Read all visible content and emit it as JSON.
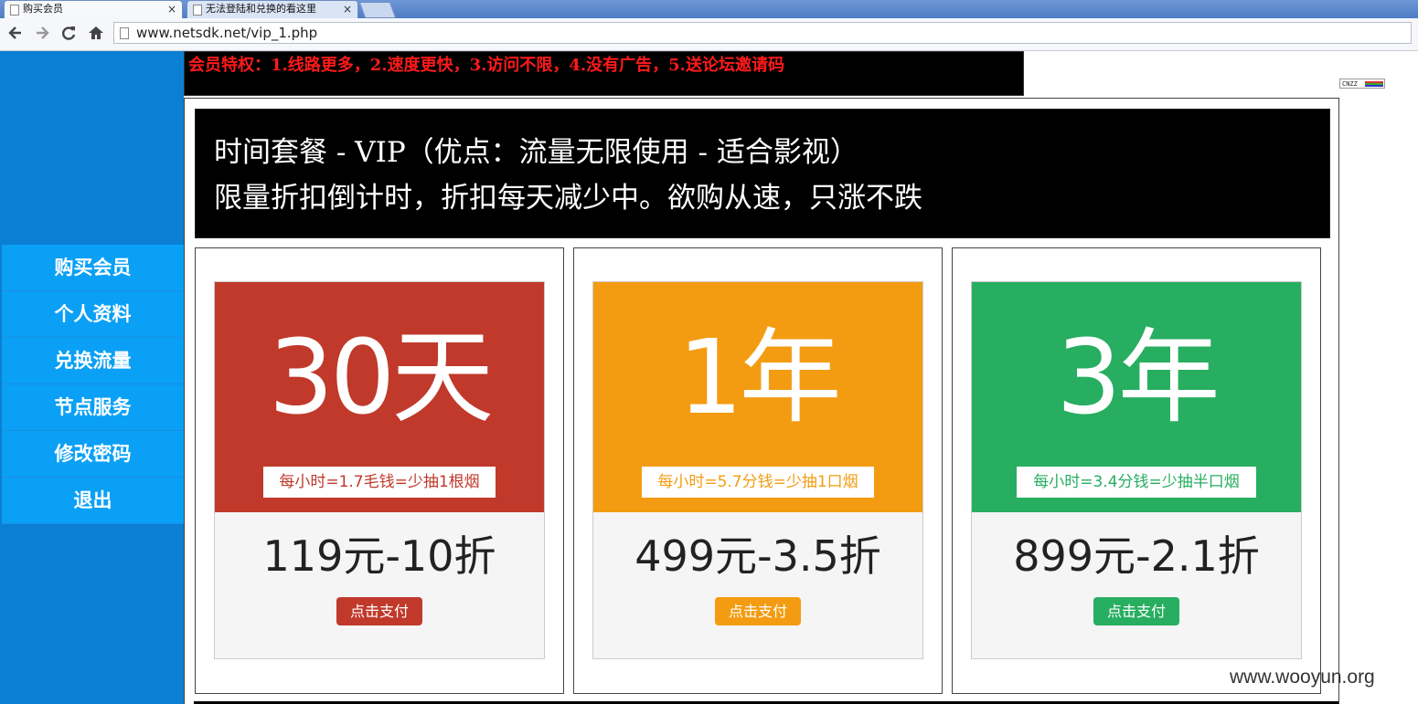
{
  "browser": {
    "tabs": [
      {
        "title": "购买会员",
        "close": "×"
      },
      {
        "title": "无法登陆和兑换的看这里",
        "close": "×"
      }
    ],
    "url": "www.netsdk.net/vip_1.php",
    "nav_icons": [
      "back-icon",
      "forward-icon",
      "reload-icon",
      "home-icon"
    ]
  },
  "announcement": "会员特权：1.线路更多，2.速度更快，3.访问不限，4.没有广告，5.送论坛邀请码",
  "sidebar": {
    "items": [
      {
        "label": "购买会员"
      },
      {
        "label": "个人资料"
      },
      {
        "label": "兑换流量"
      },
      {
        "label": "节点服务"
      },
      {
        "label": "修改密码"
      },
      {
        "label": "退出"
      }
    ]
  },
  "banner": {
    "line1": "时间套餐 - VIP（优点：流量无限使用 - 适合影视）",
    "line2": "限量折扣倒计时，折扣每天减少中。欲购从速，只涨不跌"
  },
  "plans": [
    {
      "title": "30天",
      "rate": "每小时=1.7毛钱=少抽1根烟",
      "price": "119元-10折",
      "button": "点击支付",
      "color": "#c0392b"
    },
    {
      "title": "1年",
      "rate": "每小时=5.7分钱=少抽1口烟",
      "price": "499元-3.5折",
      "button": "点击支付",
      "color": "#f39c12"
    },
    {
      "title": "3年",
      "rate": "每小时=3.4分钱=少抽半口烟",
      "price": "899元-2.1折",
      "button": "点击支付",
      "color": "#27ae60"
    }
  ],
  "cnzz_badge": "CNZZ",
  "watermark": "www.wooyun.org"
}
